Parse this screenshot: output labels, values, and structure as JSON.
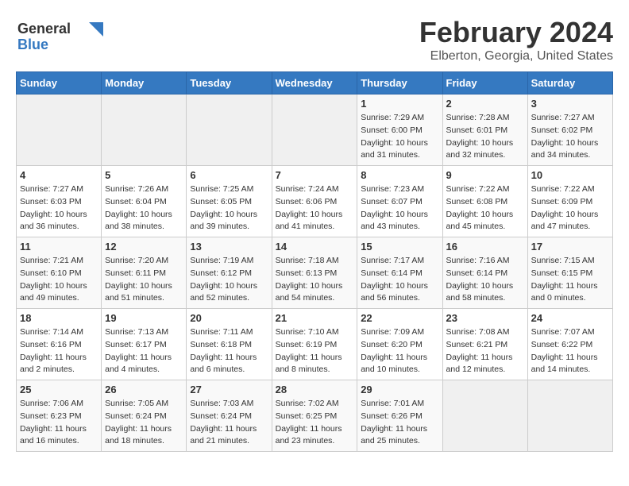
{
  "header": {
    "logo_general": "General",
    "logo_blue": "Blue",
    "title": "February 2024",
    "subtitle": "Elberton, Georgia, United States"
  },
  "days_of_week": [
    "Sunday",
    "Monday",
    "Tuesday",
    "Wednesday",
    "Thursday",
    "Friday",
    "Saturday"
  ],
  "weeks": [
    [
      {
        "day": "",
        "info": ""
      },
      {
        "day": "",
        "info": ""
      },
      {
        "day": "",
        "info": ""
      },
      {
        "day": "",
        "info": ""
      },
      {
        "day": "1",
        "info": "Sunrise: 7:29 AM\nSunset: 6:00 PM\nDaylight: 10 hours\nand 31 minutes."
      },
      {
        "day": "2",
        "info": "Sunrise: 7:28 AM\nSunset: 6:01 PM\nDaylight: 10 hours\nand 32 minutes."
      },
      {
        "day": "3",
        "info": "Sunrise: 7:27 AM\nSunset: 6:02 PM\nDaylight: 10 hours\nand 34 minutes."
      }
    ],
    [
      {
        "day": "4",
        "info": "Sunrise: 7:27 AM\nSunset: 6:03 PM\nDaylight: 10 hours\nand 36 minutes."
      },
      {
        "day": "5",
        "info": "Sunrise: 7:26 AM\nSunset: 6:04 PM\nDaylight: 10 hours\nand 38 minutes."
      },
      {
        "day": "6",
        "info": "Sunrise: 7:25 AM\nSunset: 6:05 PM\nDaylight: 10 hours\nand 39 minutes."
      },
      {
        "day": "7",
        "info": "Sunrise: 7:24 AM\nSunset: 6:06 PM\nDaylight: 10 hours\nand 41 minutes."
      },
      {
        "day": "8",
        "info": "Sunrise: 7:23 AM\nSunset: 6:07 PM\nDaylight: 10 hours\nand 43 minutes."
      },
      {
        "day": "9",
        "info": "Sunrise: 7:22 AM\nSunset: 6:08 PM\nDaylight: 10 hours\nand 45 minutes."
      },
      {
        "day": "10",
        "info": "Sunrise: 7:22 AM\nSunset: 6:09 PM\nDaylight: 10 hours\nand 47 minutes."
      }
    ],
    [
      {
        "day": "11",
        "info": "Sunrise: 7:21 AM\nSunset: 6:10 PM\nDaylight: 10 hours\nand 49 minutes."
      },
      {
        "day": "12",
        "info": "Sunrise: 7:20 AM\nSunset: 6:11 PM\nDaylight: 10 hours\nand 51 minutes."
      },
      {
        "day": "13",
        "info": "Sunrise: 7:19 AM\nSunset: 6:12 PM\nDaylight: 10 hours\nand 52 minutes."
      },
      {
        "day": "14",
        "info": "Sunrise: 7:18 AM\nSunset: 6:13 PM\nDaylight: 10 hours\nand 54 minutes."
      },
      {
        "day": "15",
        "info": "Sunrise: 7:17 AM\nSunset: 6:14 PM\nDaylight: 10 hours\nand 56 minutes."
      },
      {
        "day": "16",
        "info": "Sunrise: 7:16 AM\nSunset: 6:14 PM\nDaylight: 10 hours\nand 58 minutes."
      },
      {
        "day": "17",
        "info": "Sunrise: 7:15 AM\nSunset: 6:15 PM\nDaylight: 11 hours\nand 0 minutes."
      }
    ],
    [
      {
        "day": "18",
        "info": "Sunrise: 7:14 AM\nSunset: 6:16 PM\nDaylight: 11 hours\nand 2 minutes."
      },
      {
        "day": "19",
        "info": "Sunrise: 7:13 AM\nSunset: 6:17 PM\nDaylight: 11 hours\nand 4 minutes."
      },
      {
        "day": "20",
        "info": "Sunrise: 7:11 AM\nSunset: 6:18 PM\nDaylight: 11 hours\nand 6 minutes."
      },
      {
        "day": "21",
        "info": "Sunrise: 7:10 AM\nSunset: 6:19 PM\nDaylight: 11 hours\nand 8 minutes."
      },
      {
        "day": "22",
        "info": "Sunrise: 7:09 AM\nSunset: 6:20 PM\nDaylight: 11 hours\nand 10 minutes."
      },
      {
        "day": "23",
        "info": "Sunrise: 7:08 AM\nSunset: 6:21 PM\nDaylight: 11 hours\nand 12 minutes."
      },
      {
        "day": "24",
        "info": "Sunrise: 7:07 AM\nSunset: 6:22 PM\nDaylight: 11 hours\nand 14 minutes."
      }
    ],
    [
      {
        "day": "25",
        "info": "Sunrise: 7:06 AM\nSunset: 6:23 PM\nDaylight: 11 hours\nand 16 minutes."
      },
      {
        "day": "26",
        "info": "Sunrise: 7:05 AM\nSunset: 6:24 PM\nDaylight: 11 hours\nand 18 minutes."
      },
      {
        "day": "27",
        "info": "Sunrise: 7:03 AM\nSunset: 6:24 PM\nDaylight: 11 hours\nand 21 minutes."
      },
      {
        "day": "28",
        "info": "Sunrise: 7:02 AM\nSunset: 6:25 PM\nDaylight: 11 hours\nand 23 minutes."
      },
      {
        "day": "29",
        "info": "Sunrise: 7:01 AM\nSunset: 6:26 PM\nDaylight: 11 hours\nand 25 minutes."
      },
      {
        "day": "",
        "info": ""
      },
      {
        "day": "",
        "info": ""
      }
    ]
  ]
}
